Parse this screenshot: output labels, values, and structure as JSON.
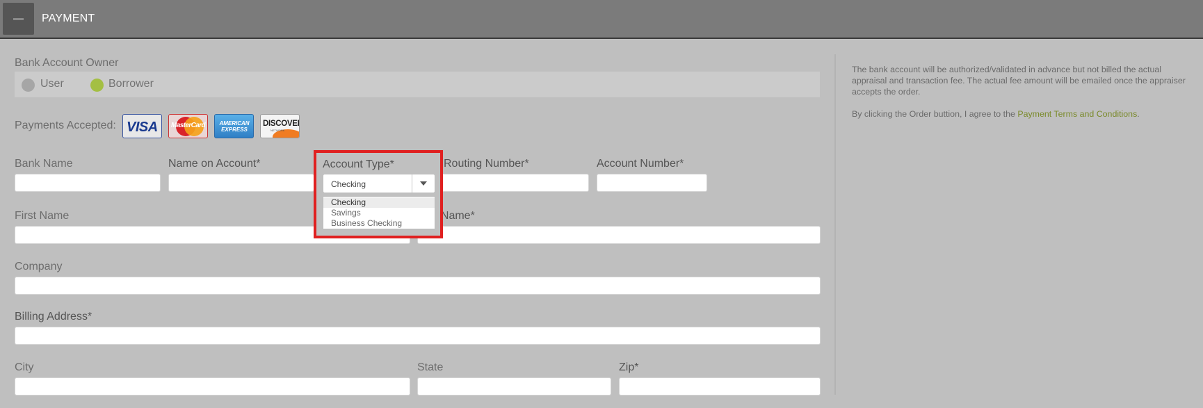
{
  "header": {
    "title": "PAYMENT"
  },
  "owner": {
    "label": "Bank Account Owner",
    "options": [
      "User",
      "Borrower"
    ],
    "selected": "Borrower"
  },
  "payments": {
    "label": "Payments Accepted:",
    "cards": [
      "VISA",
      "MasterCard",
      "AMERICAN EXPRESS",
      "DISCOVER",
      "NETWORK"
    ]
  },
  "fields": {
    "bank_name": "Bank Name",
    "name_on_account": "Name on Account*",
    "account_type": "Account Type*",
    "routing_number": "Routing Number*",
    "account_number": "Account Number*",
    "first_name": "First Name",
    "last_name_visible": "t Name*",
    "company": "Company",
    "billing_address": "Billing Address*",
    "city": "City",
    "state": "State",
    "zip": "Zip*"
  },
  "account_type_select": {
    "value": "Checking",
    "options": [
      "Checking",
      "Savings",
      "Business Checking"
    ]
  },
  "side": {
    "notice": "The bank account will be authorized/validated in advance but not billed the actual appraisal and transaction fee. The actual fee amount will be emailed once the appraiser accepts the order.",
    "agree_prefix": "By clicking the Order buttion, I agree to the ",
    "agree_link": "Payment Terms and Conditions",
    "agree_suffix": "."
  },
  "colors": {
    "header_bg": "#7b7b7b",
    "page_bg": "#bfbfbf",
    "radio_selected": "#a4bf43",
    "highlight": "#e02020",
    "link": "#7a8a2a"
  }
}
